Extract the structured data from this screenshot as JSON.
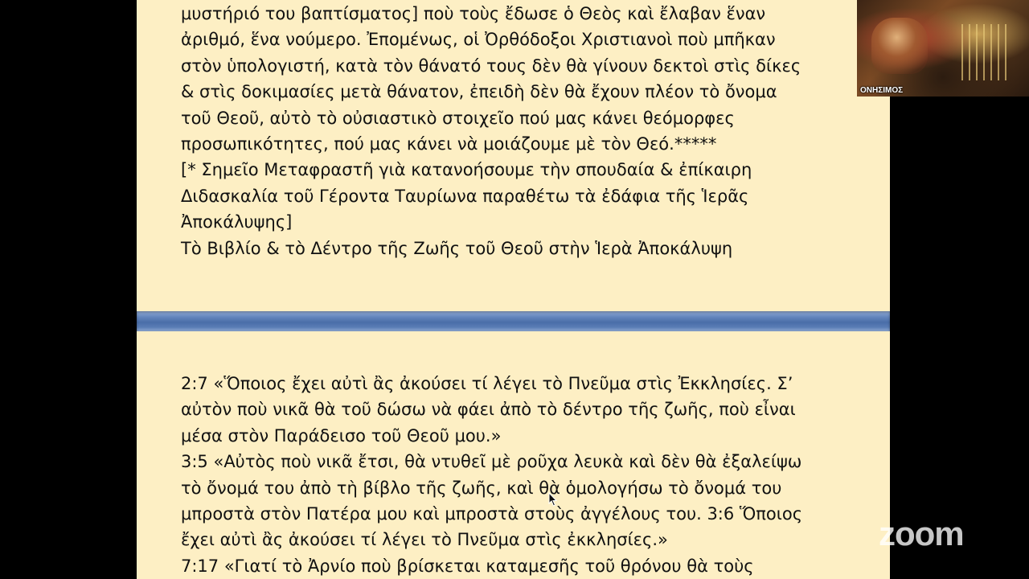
{
  "slide_top": {
    "lines": [
      "μυστήριό του βαπτίσματος] ποὺ τοὺς ἔδωσε ὁ Θεὸς καὶ ἔλαβαν ἕναν",
      "ἀριθμό, ἕνα νούμερο. Ἐπομένως, οἱ Ὀρθόδοξοι Χριστιανοὶ ποὺ μπῆκαν",
      "στὸν ὑπολογιστή, κατὰ τὸν θάνατό τους δὲν θὰ γίνουν δεκτοὶ στὶς δίκες",
      "& στὶς δοκιμασίες μετὰ θάνατον, ἐπειδὴ δὲν θὰ ἔχουν πλέον τὸ ὄνομα",
      "τοῦ Θεοῦ, αὐτὸ τὸ οὐσιαστικὸ στοιχεῖο πού μας κάνει θεόμορφες",
      "προσωπικότητες, πού μας κάνει νὰ μοιάζουμε μὲ τὸν Θεό.*****",
      "[* Σημεῖο Μεταφραστῆ γιὰ κατανοήσουμε τὴν σπουδαία & ἐπίκαιρη",
      "Διδασκαλία τοῦ Γέροντα Ταυρίωνα παραθέτω τὰ ἐδάφια τῆς Ἱερᾶς",
      "Ἀποκάλυψης]",
      "Τὸ Βιβλίο & τὸ Δέντρο τῆς Ζωῆς τοῦ Θεοῦ στὴν Ἱερὰ Ἀποκάλυψη"
    ]
  },
  "slide_bottom": {
    "lines": [
      "2:7 «Ὅποιος ἔχει αὐτὶ ἂς ἀκούσει τί λέγει τὸ Πνεῦμα στὶς Ἐκκλησίες. Σ’",
      "αὐτὸν ποὺ νικᾶ θὰ τοῦ δώσω νὰ φάει ἀπὸ τὸ δέντρο τῆς ζωῆς, ποὺ εἶναι",
      "μέσα στὸν Παράδεισο τοῦ Θεοῦ μου.»",
      "3:5 «Αὐτὸς ποὺ νικᾶ ἔτσι, θὰ ντυθεῖ μὲ ροῦχα λευκὰ καὶ δὲν θὰ ἐξαλείψω",
      "τὸ ὄνομά του ἀπὸ τὴ βίβλο τῆς ζωῆς, καὶ θὰ ὁμολογήσω τὸ ὄνομά του",
      "μπροστὰ στὸν Πατέρα μου καὶ μπροστὰ στοὺς ἀγγέλους του. 3:6 Ὅποιος",
      "ἔχει αὐτὶ ἂς ἀκούσει τί λέγει τὸ Πνεῦμα στὶς ἐκκλησίες.»",
      "7:17 «Γιατί τὸ Ἀρνίο ποὺ βρίσκεται καταμεσῆς τοῦ θρόνου θὰ τοὺς"
    ]
  },
  "participant_video": {
    "name": "ΟΝΗΣΙΜΟΣ"
  },
  "watermark": {
    "text": "zoom"
  },
  "colors": {
    "slide_background": "#fdefc4",
    "divider": "#5a7db5",
    "text": "#111111",
    "screen_background": "#000000"
  },
  "icons": {
    "cursor": "arrow-cursor-icon"
  }
}
